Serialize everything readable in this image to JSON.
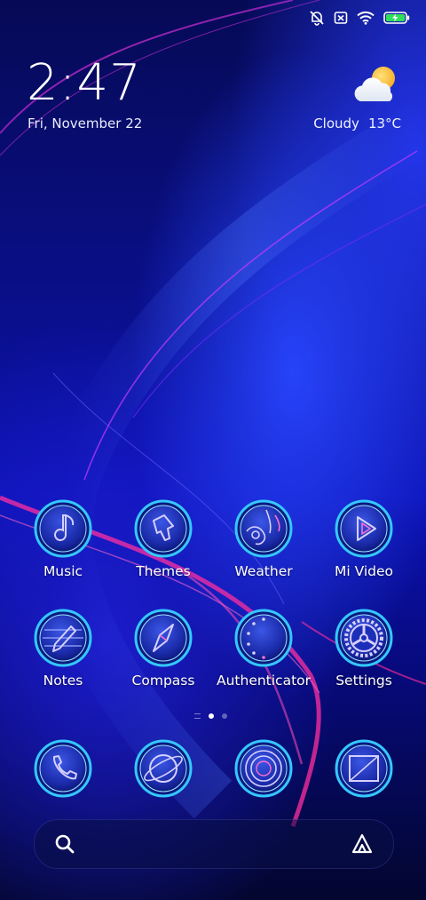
{
  "status": {
    "icons": [
      "bell-off-icon",
      "sim-off-icon",
      "wifi-icon",
      "battery-charging-icon"
    ]
  },
  "lockinfo": {
    "time": "2:47",
    "date": "Fri, November 22"
  },
  "weather": {
    "condition": "Cloudy",
    "temp": "13°C",
    "icon": "partly-cloudy-icon"
  },
  "apps": [
    {
      "label": "Music",
      "icon": "music-note-icon"
    },
    {
      "label": "Themes",
      "icon": "paint-brush-icon"
    },
    {
      "label": "Weather",
      "icon": "weather-globe-icon"
    },
    {
      "label": "Mi Video",
      "icon": "play-icon"
    },
    {
      "label": "Notes",
      "icon": "pencil-icon"
    },
    {
      "label": "Compass",
      "icon": "compass-icon"
    },
    {
      "label": "Authenticator",
      "icon": "authenticator-icon"
    },
    {
      "label": "Settings",
      "icon": "gear-icon"
    }
  ],
  "page_indicator": {
    "pages": 2,
    "active": 1
  },
  "dock": [
    {
      "icon": "phone-icon"
    },
    {
      "icon": "browser-icon"
    },
    {
      "icon": "camera-icon"
    },
    {
      "icon": "messages-icon"
    }
  ],
  "search": {
    "icon": "search-icon",
    "assistant_icon": "assistant-icon"
  },
  "colors": {
    "bg_dark": "#060a55",
    "bg_blue": "#1a2cff",
    "accent_pink": "#ff2fa0",
    "icon_ring": "#35c8ff"
  }
}
